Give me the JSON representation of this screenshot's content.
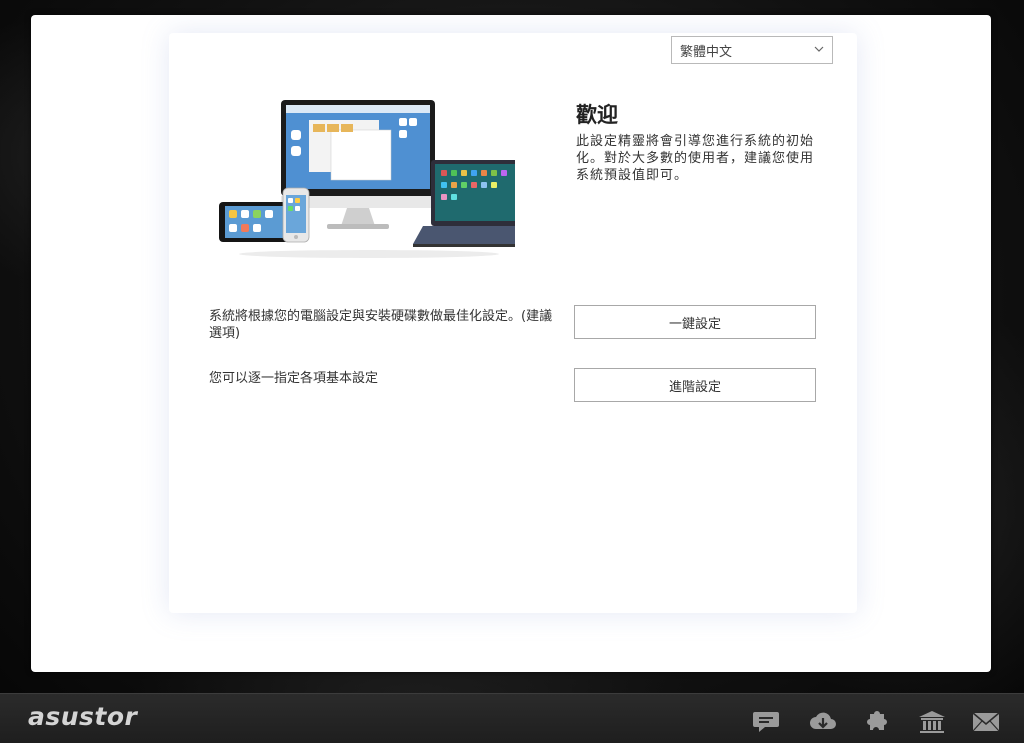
{
  "language_select": {
    "value": "繁體中文"
  },
  "welcome": {
    "title": "歡迎",
    "description": "此設定精靈將會引導您進行系統的初始化。對於大多數的使用者，建議您使用系統預設值即可。"
  },
  "options": [
    {
      "text": "系統將根據您的電腦設定與安裝硬碟數做最佳化設定。(建議選項)",
      "button": "一鍵設定"
    },
    {
      "text": "您可以逐一指定各項基本設定",
      "button": "進階設定"
    }
  ],
  "taskbar": {
    "logo": "asustor",
    "icons": [
      "chat-icon",
      "cloud-download-icon",
      "plugin-icon",
      "bank-icon",
      "mail-icon"
    ]
  },
  "colors": {
    "accent": "#3b7fd6",
    "tray_icon": "#9a9a9a",
    "laptop_screen": "#1f6a6e"
  }
}
